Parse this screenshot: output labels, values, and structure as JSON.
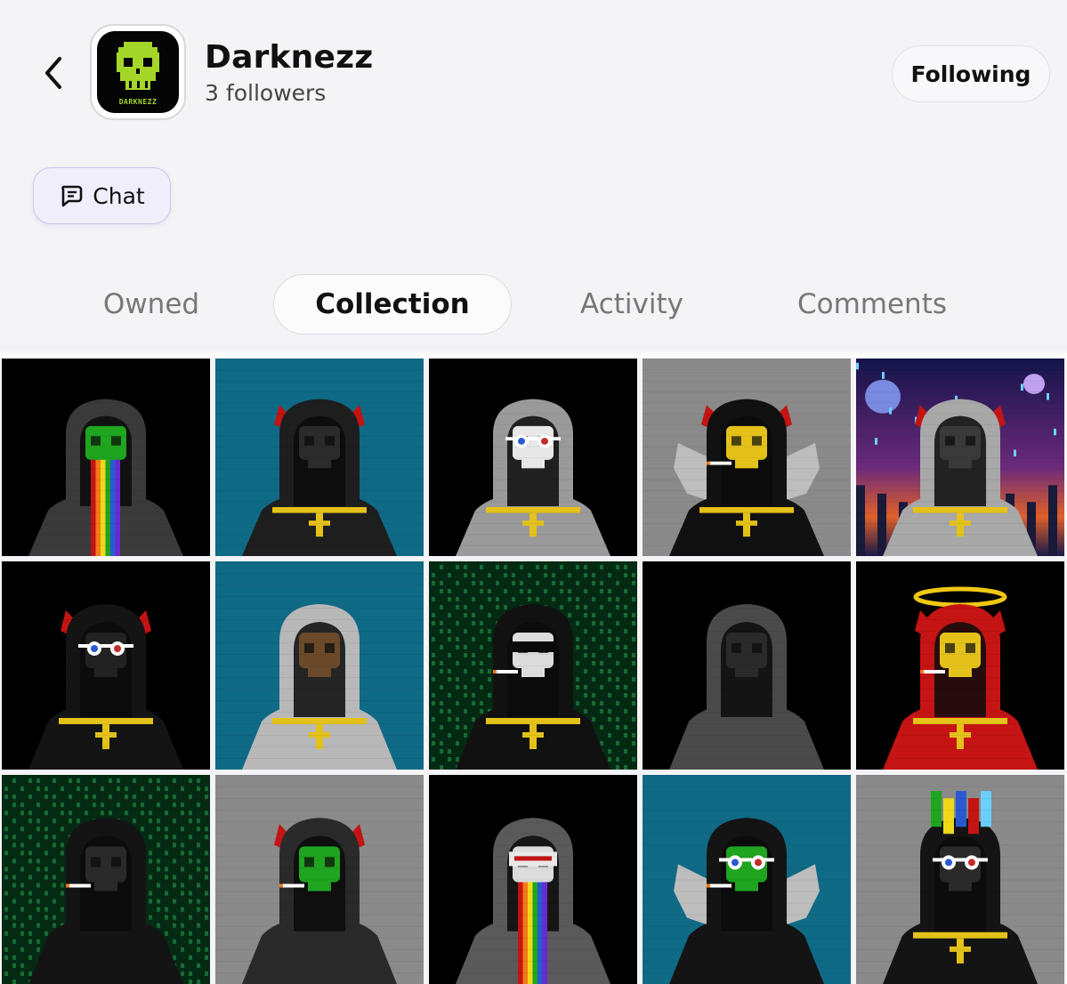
{
  "header": {
    "back_icon": "chevron-left-icon",
    "name": "Darknezz",
    "followers_count": "3",
    "followers_label": "followers",
    "avatar_logo_text": "DARKNEZZ",
    "follow_button_label": "Following"
  },
  "actions": {
    "chat_label": "Chat",
    "chat_icon": "chat-bubble-icon"
  },
  "tabs": [
    {
      "label": "Owned",
      "active": false
    },
    {
      "label": "Collection",
      "active": true
    },
    {
      "label": "Activity",
      "active": false
    },
    {
      "label": "Comments",
      "active": false
    }
  ],
  "colors": {
    "accent_purple": "#cfc4ec",
    "avatar_skull": "#a4d62a"
  },
  "collection_items": [
    {
      "bg": "#000000",
      "hood": "#3a3a3a",
      "face": "#1fa51f",
      "horns": false,
      "halo": false,
      "necklace": false,
      "rainbow": true,
      "glasses": "none",
      "cig": false,
      "wings": false,
      "pattern": "none",
      "bright": false
    },
    {
      "bg": "#0f6a86",
      "hood": "#1e1e1e",
      "face": "#2b2b2b",
      "horns": true,
      "halo": false,
      "necklace": true,
      "rainbow": false,
      "glasses": "none",
      "cig": false,
      "wings": false,
      "pattern": "none",
      "bright": false
    },
    {
      "bg": "#000000",
      "hood": "#9a9a9a",
      "face": "#e8e8e8",
      "horns": false,
      "halo": false,
      "necklace": true,
      "rainbow": false,
      "glasses": "3d",
      "cig": false,
      "wings": false,
      "pattern": "none",
      "bright": true
    },
    {
      "bg": "#8a8a8a",
      "hood": "#111111",
      "face": "#e5c21a",
      "horns": true,
      "halo": false,
      "necklace": true,
      "rainbow": false,
      "glasses": "none",
      "cig": true,
      "wings": true,
      "pattern": "none",
      "bright": false
    },
    {
      "bg": "#1a1a5a",
      "hood": "#a8a8a8",
      "face": "#3a3a3a",
      "horns": true,
      "halo": false,
      "necklace": true,
      "rainbow": false,
      "glasses": "none",
      "cig": false,
      "wings": false,
      "pattern": "space",
      "bright": true
    },
    {
      "bg": "#000000",
      "hood": "#141414",
      "face": "#222222",
      "horns": true,
      "halo": false,
      "necklace": true,
      "rainbow": false,
      "glasses": "round",
      "cig": false,
      "wings": false,
      "pattern": "none",
      "bright": false
    },
    {
      "bg": "#0f6a86",
      "hood": "#b8b8b8",
      "face": "#6a4a2a",
      "horns": false,
      "halo": false,
      "necklace": true,
      "rainbow": false,
      "glasses": "none",
      "cig": false,
      "wings": false,
      "pattern": "none",
      "bright": true
    },
    {
      "bg": "#042a14",
      "hood": "#111111",
      "face": "#dcdcdc",
      "horns": false,
      "halo": false,
      "necklace": true,
      "rainbow": false,
      "glasses": "shades",
      "cig": true,
      "wings": false,
      "pattern": "matrix",
      "bright": false
    },
    {
      "bg": "#000000",
      "hood": "#4a4a4a",
      "face": "#2a2a2a",
      "horns": false,
      "halo": false,
      "necklace": false,
      "rainbow": false,
      "glasses": "none",
      "cig": false,
      "wings": false,
      "pattern": "none",
      "bright": false
    },
    {
      "bg": "#000000",
      "hood": "#c41414",
      "face": "#e5c21a",
      "horns": true,
      "halo": true,
      "necklace": true,
      "rainbow": false,
      "glasses": "none",
      "cig": true,
      "wings": false,
      "pattern": "none",
      "bright": false
    },
    {
      "bg": "#042a14",
      "hood": "#141414",
      "face": "#2a2a2a",
      "horns": false,
      "halo": false,
      "necklace": false,
      "rainbow": false,
      "glasses": "none",
      "cig": true,
      "wings": false,
      "pattern": "matrix",
      "bright": false
    },
    {
      "bg": "#8a8a8a",
      "hood": "#2a2a2a",
      "face": "#1fa51f",
      "horns": true,
      "halo": false,
      "necklace": false,
      "rainbow": false,
      "glasses": "none",
      "cig": true,
      "wings": false,
      "pattern": "none",
      "bright": false
    },
    {
      "bg": "#000000",
      "hood": "#5a5a5a",
      "face": "#dcdcdc",
      "horns": false,
      "halo": false,
      "necklace": false,
      "rainbow": true,
      "glasses": "visor",
      "cig": false,
      "wings": false,
      "pattern": "none",
      "bright": false
    },
    {
      "bg": "#0f6a86",
      "hood": "#141414",
      "face": "#1fa51f",
      "horns": false,
      "halo": false,
      "necklace": false,
      "rainbow": false,
      "glasses": "round",
      "cig": true,
      "wings": true,
      "pattern": "none",
      "bright": false
    },
    {
      "bg": "#8a8a8a",
      "hood": "#141414",
      "face": "#2a2a2a",
      "horns": false,
      "halo": false,
      "necklace": true,
      "rainbow": false,
      "glasses": "round",
      "cig": false,
      "wings": false,
      "pattern": "mohawk",
      "bright": false
    }
  ]
}
